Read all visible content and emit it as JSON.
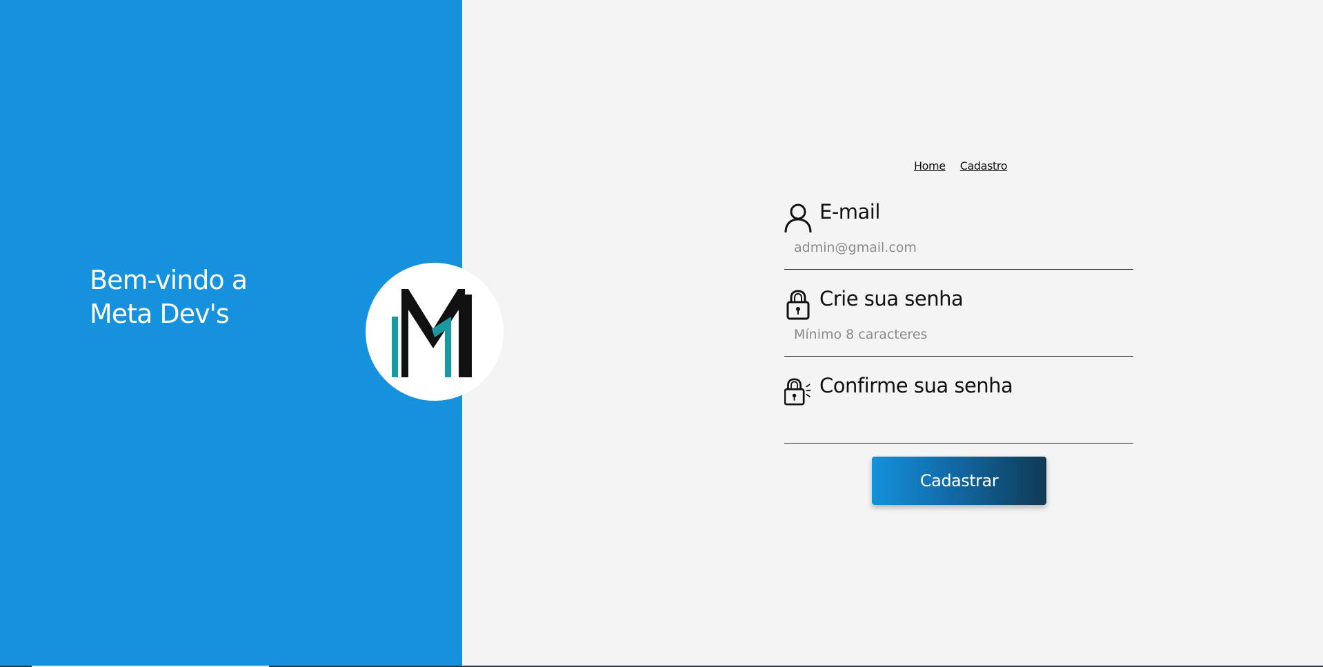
{
  "brand": {
    "welcome_line1": "Bem-vindo a",
    "welcome_line2": "Meta Dev's",
    "panel_color": "#1591dd",
    "logo_icon": "meta-devs-m-logo"
  },
  "nav": {
    "items": [
      {
        "label": "Home"
      },
      {
        "label": "Cadastro"
      }
    ]
  },
  "form": {
    "email": {
      "label": "E-mail",
      "icon": "user-icon",
      "placeholder": "admin@gmail.com",
      "value": ""
    },
    "password": {
      "label": "Crie sua senha",
      "icon": "lock-icon",
      "placeholder": "Mínimo 8 caracteres",
      "value": ""
    },
    "confirm_password": {
      "label": "Confirme sua senha",
      "icon": "unlock-icon",
      "placeholder": "",
      "value": ""
    },
    "submit_label": "Cadastrar"
  }
}
